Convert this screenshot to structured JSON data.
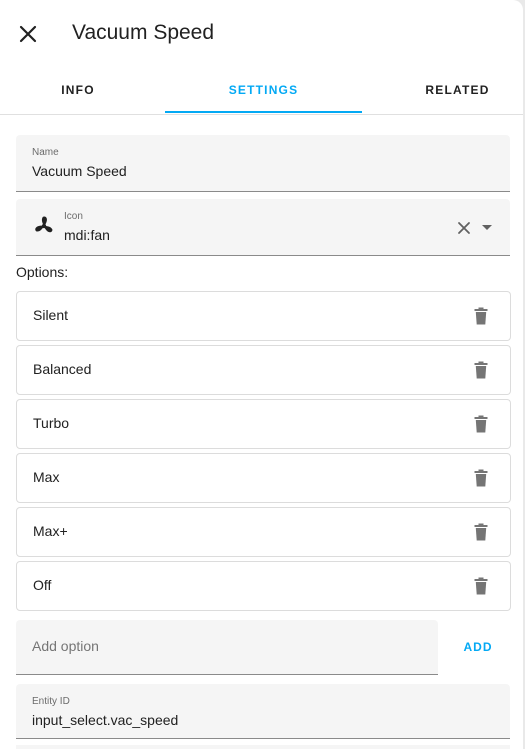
{
  "dialog": {
    "title": "Vacuum Speed"
  },
  "tabs": [
    {
      "label": "INFO"
    },
    {
      "label": "SETTINGS"
    },
    {
      "label": "RELATED"
    }
  ],
  "name_field": {
    "label": "Name",
    "value": "Vacuum Speed"
  },
  "icon_field": {
    "label": "Icon",
    "value": "mdi:fan",
    "icon": "fan-icon"
  },
  "options": {
    "label": "Options:",
    "items": [
      {
        "label": "Silent"
      },
      {
        "label": "Balanced"
      },
      {
        "label": "Turbo"
      },
      {
        "label": "Max"
      },
      {
        "label": "Max+"
      },
      {
        "label": "Off"
      }
    ]
  },
  "add_option": {
    "placeholder": "Add option",
    "button": "ADD"
  },
  "entity_field": {
    "label": "Entity ID",
    "value": "input_select.vac_speed"
  },
  "colors": {
    "accent": "#03a9f4",
    "text": "#212121",
    "field_bg": "#f5f5f5",
    "icon_gray": "#757575"
  }
}
